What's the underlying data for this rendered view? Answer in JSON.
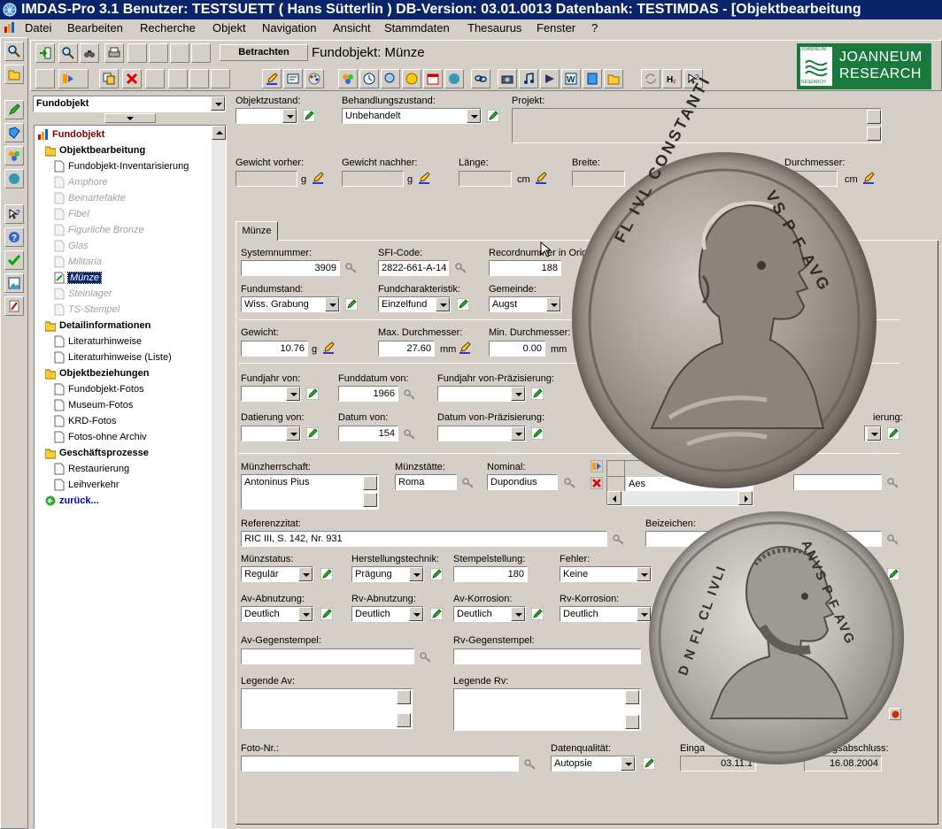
{
  "titlebar": {
    "text": "IMDAS-Pro 3.1  Benutzer: TESTSUETT ( Hans Sütterlin )   DB-Version: 03.01.0013   Datenbank: TESTIMDAS - [Objektbearbeitung"
  },
  "menu": [
    "Datei",
    "Bearbeiten",
    "Recherche",
    "Objekt",
    "Navigation",
    "Ansicht",
    "Stammdaten",
    "Thesaurus",
    "Fenster",
    "?"
  ],
  "toolbar": {
    "betrachten": "Betrachten",
    "object_title": "Fundobjekt: Münze"
  },
  "logo": {
    "top": "JOANNEUM",
    "bottom": "RESEARCH",
    "small_top": "JOANNEUM",
    "small_bottom": "RESEARCH"
  },
  "tree": {
    "combo_value": "Fundobjekt",
    "root": "Fundobjekt",
    "items": [
      {
        "label": "Objektbearbeitung",
        "type": "folder"
      },
      {
        "label": "Fundobjekt-Inventarisierung",
        "type": "doc"
      },
      {
        "label": "Amphore",
        "type": "disabled"
      },
      {
        "label": "Beinartefakte",
        "type": "disabled"
      },
      {
        "label": "Fibel",
        "type": "disabled"
      },
      {
        "label": "Figurliche Bronze",
        "type": "disabled"
      },
      {
        "label": "Glas",
        "type": "disabled"
      },
      {
        "label": "Militaria",
        "type": "disabled"
      },
      {
        "label": "Münze",
        "type": "selected"
      },
      {
        "label": "Steinlager",
        "type": "disabled"
      },
      {
        "label": "TS-Stempel",
        "type": "disabled"
      },
      {
        "label": "Detailinformationen",
        "type": "folder"
      },
      {
        "label": "Literaturhinweise",
        "type": "doc"
      },
      {
        "label": "Literaturhinweise (Liste)",
        "type": "doc"
      },
      {
        "label": "Objektbeziehungen",
        "type": "folder"
      },
      {
        "label": "Fundobjekt-Fotos",
        "type": "doc"
      },
      {
        "label": "Museum-Fotos",
        "type": "doc"
      },
      {
        "label": "KRD-Fotos",
        "type": "doc"
      },
      {
        "label": "Fotos-ohne Archiv",
        "type": "doc"
      },
      {
        "label": "Geschäftsprozesse",
        "type": "folder"
      },
      {
        "label": "Restaurierung",
        "type": "doc"
      },
      {
        "label": "Leihverkehr",
        "type": "doc"
      },
      {
        "label": "zurück...",
        "type": "back"
      }
    ]
  },
  "top": {
    "objektzustand": {
      "label": "Objektzustand:",
      "value": ""
    },
    "behandlungszustand": {
      "label": "Behandlungszustand:",
      "value": "Unbehandelt"
    },
    "projekt": {
      "label": "Projekt:",
      "value": ""
    },
    "gewicht_vorher": {
      "label": "Gewicht vorher:",
      "unit": "g"
    },
    "gewicht_nachher": {
      "label": "Gewicht nachher:",
      "unit": "g"
    },
    "laenge": {
      "label": "Länge:",
      "unit": "cm"
    },
    "breite": {
      "label": "Breite:"
    },
    "durchmesser": {
      "label": "Durchmesser:",
      "unit": "cm"
    }
  },
  "tab": {
    "label": "Münze"
  },
  "form": {
    "systemnummer": {
      "label": "Systemnummer:",
      "value": "3909"
    },
    "sfi_code": {
      "label": "SFI-Code:",
      "value": "2822-661-A-14"
    },
    "recordnummer": {
      "label": "Recordnummer in Orig",
      "value": "188"
    },
    "fundumstand": {
      "label": "Fundumstand:",
      "value": "Wiss. Grabung"
    },
    "fundcharakteristik": {
      "label": "Fundcharakteristik:",
      "value": "Einzelfund"
    },
    "gemeinde": {
      "label": "Gemeinde:",
      "value": "Augst"
    },
    "gewicht": {
      "label": "Gewicht:",
      "value": "10.76",
      "unit": "g"
    },
    "max_durchmesser": {
      "label": "Max. Durchmesser:",
      "value": "27.60",
      "unit": "mm"
    },
    "min_durchmesser": {
      "label": "Min. Durchmesser:",
      "value": "0.00",
      "unit": "mm"
    },
    "fundjahr_von": {
      "label": "Fundjahr von:",
      "value": ""
    },
    "funddatum_von": {
      "label": "Funddatum von:",
      "value": "1966"
    },
    "fundjahr_praez": {
      "label": "Fundjahr von-Präzisierung:",
      "value": ""
    },
    "datierung_von": {
      "label": "Datierung von:",
      "value": ""
    },
    "datum_von": {
      "label": "Datum von:",
      "value": "154"
    },
    "datum_praez": {
      "label": "Datum von-Präzisierung:",
      "value": ""
    },
    "ierung": {
      "label": "ierung:"
    },
    "muenzherrschaft": {
      "label": "Münzherrschaft:",
      "value": "Antoninus Pius"
    },
    "muenzstaette": {
      "label": "Münzstätte:",
      "value": "Roma"
    },
    "nominal": {
      "label": "Nominal:",
      "value": "Dupondius"
    },
    "grid_value": "Aes",
    "referenzzitat": {
      "label": "Referenzzitat:",
      "value": "RIC III, S. 142, Nr. 931"
    },
    "beizeichen": {
      "label": "Beizeichen:",
      "value": ""
    },
    "muenzstatus": {
      "label": "Münzstatus:",
      "value": "Regulär"
    },
    "herstellungstechnik": {
      "label": "Herstellungstechnik:",
      "value": "Prägung"
    },
    "stempelstellung": {
      "label": "Stempelstellung:",
      "value": "180"
    },
    "fehler": {
      "label": "Fehler:",
      "value": "Keine"
    },
    "av_abnutzung": {
      "label": "Av-Abnutzung:",
      "value": "Deutlich"
    },
    "rv_abnutzung": {
      "label": "Rv-Abnutzung:",
      "value": "Deutlich"
    },
    "av_korrosion": {
      "label": "Av-Korrosion:",
      "value": "Deutlich"
    },
    "rv_korrosion": {
      "label": "Rv-Korrosion:",
      "value": "Deutlich"
    },
    "av_gegenstempel": {
      "label": "Av-Gegenstempel:",
      "value": ""
    },
    "rv_gegenstempel": {
      "label": "Rv-Gegenstempel:",
      "value": ""
    },
    "legende_av": {
      "label": "Legende Av:",
      "value": ""
    },
    "legende_rv": {
      "label": "Legende Rv:",
      "value": ""
    },
    "foto_nr": {
      "label": "Foto-Nr.:",
      "value": ""
    },
    "datenqualitaet": {
      "label": "Datenqualität:",
      "value": "Autopsie"
    },
    "eingabe": {
      "label": "Einga",
      "value": "03.11.1"
    },
    "abschluss": {
      "label": "gsabschluss:",
      "value": "16.08.2004"
    }
  },
  "coin1": {
    "legend_left": "FL IVL CONSTANTI",
    "legend_right": "VS P F AVG"
  },
  "coin2": {
    "legend_left": "D N FL CL IVLI",
    "legend_right": "ANVS P F AVG"
  }
}
